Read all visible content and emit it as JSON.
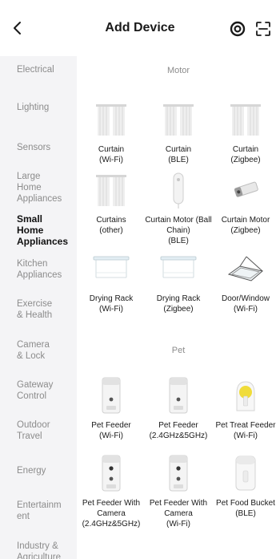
{
  "header": {
    "title": "Add Device"
  },
  "sidebar": {
    "items": [
      {
        "label": "Electrical",
        "active": false
      },
      {
        "label": "Lighting",
        "active": false
      },
      {
        "label": "Sensors",
        "active": false
      },
      {
        "label": "Large\nHome\nAppliances",
        "active": false
      },
      {
        "label": "Small\nHome\nAppliances",
        "active": true
      },
      {
        "label": "Kitchen\nAppliances",
        "active": false
      },
      {
        "label": "Exercise\n& Health",
        "active": false
      },
      {
        "label": "Camera\n& Lock",
        "active": false
      },
      {
        "label": "Gateway\nControl",
        "active": false
      },
      {
        "label": "Outdoor\nTravel",
        "active": false
      },
      {
        "label": "Energy",
        "active": false
      },
      {
        "label": "Entertainm\nent",
        "active": false
      },
      {
        "label": "Industry &\nAgriculture",
        "active": false
      }
    ]
  },
  "sections": {
    "motor": {
      "title": "Motor",
      "devices": [
        {
          "label": "Curtain\n(Wi-Fi)",
          "icon": "curtain-icon"
        },
        {
          "label": "Curtain\n(BLE)",
          "icon": "curtain-icon"
        },
        {
          "label": "Curtain\n(Zigbee)",
          "icon": "curtain-icon"
        },
        {
          "label": "Curtains\n(other)",
          "icon": "curtain-icon"
        },
        {
          "label": "Curtain Motor (Ball\nChain)\n(BLE)",
          "icon": "curtain-motor-ball-icon"
        },
        {
          "label": "Curtain Motor\n(Zigbee)",
          "icon": "curtain-motor-icon"
        },
        {
          "label": "Drying Rack\n(Wi-Fi)",
          "icon": "drying-rack-icon"
        },
        {
          "label": "Drying Rack\n(Zigbee)",
          "icon": "drying-rack-icon"
        },
        {
          "label": "Door/Window\n(Wi-Fi)",
          "icon": "window-icon"
        }
      ]
    },
    "pet": {
      "title": "Pet",
      "devices": [
        {
          "label": "Pet Feeder\n(Wi-Fi)",
          "icon": "pet-feeder-icon"
        },
        {
          "label": "Pet Feeder\n(2.4GHz&5GHz)",
          "icon": "pet-feeder-icon"
        },
        {
          "label": "Pet Treat Feeder\n(Wi-Fi)",
          "icon": "pet-treat-feeder-icon"
        },
        {
          "label": "Pet Feeder With\nCamera\n(2.4GHz&5GHz)",
          "icon": "pet-feeder-camera-icon"
        },
        {
          "label": "Pet Feeder With\nCamera\n(Wi-Fi)",
          "icon": "pet-feeder-camera-icon"
        },
        {
          "label": "Pet Food Bucket\n(BLE)",
          "icon": "pet-food-bucket-icon"
        }
      ]
    }
  }
}
